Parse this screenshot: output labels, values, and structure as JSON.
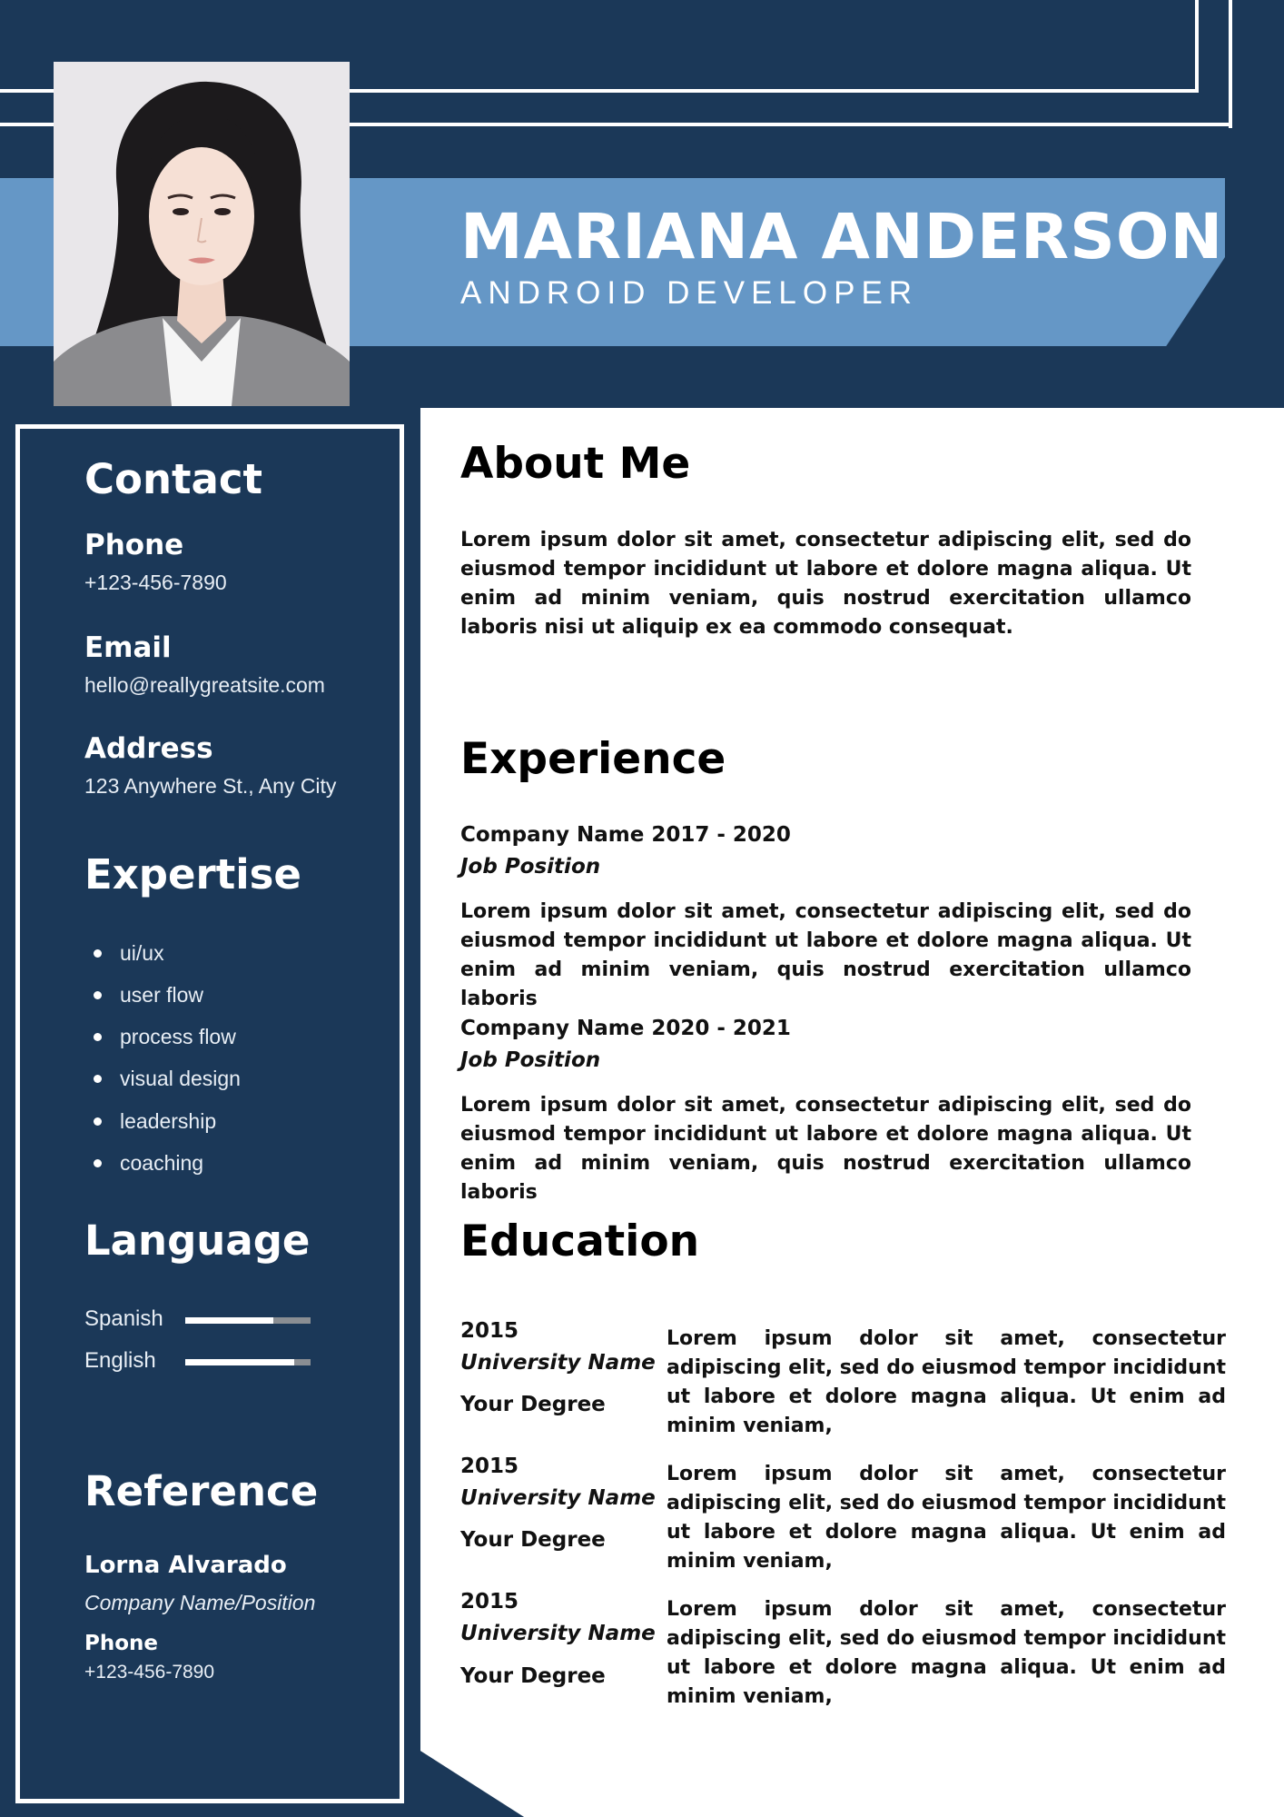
{
  "header": {
    "name": "MARIANA ANDERSON",
    "title": "ANDROID DEVELOPER"
  },
  "colors": {
    "navy": "#1b3858",
    "banner_blue": "#6597c6",
    "white": "#ffffff"
  },
  "sidebar": {
    "contact": {
      "heading": "Contact",
      "phone_label": "Phone",
      "phone_value": "+123-456-7890",
      "email_label": "Email",
      "email_value": "hello@reallygreatsite.com",
      "address_label": "Address",
      "address_value": "123 Anywhere St., Any City"
    },
    "expertise": {
      "heading": "Expertise",
      "items": [
        "ui/ux",
        "user flow",
        "process flow",
        "visual design",
        "leadership",
        "coaching"
      ]
    },
    "language": {
      "heading": "Language",
      "items": [
        {
          "label": "Spanish",
          "level": 0.7
        },
        {
          "label": "English",
          "level": 0.87
        }
      ]
    },
    "reference": {
      "heading": "Reference",
      "name": "Lorna Alvarado",
      "company": "Company Name/Position",
      "phone_label": "Phone",
      "phone_value": "+123-456-7890"
    }
  },
  "main": {
    "about": {
      "heading": "About Me",
      "text": "Lorem ipsum dolor sit amet, consectetur adipiscing elit, sed do eiusmod tempor incididunt ut labore et dolore magna aliqua. Ut enim ad minim veniam, quis nostrud exercitation ullamco laboris nisi ut aliquip ex ea commodo consequat."
    },
    "experience": {
      "heading": "Experience",
      "jobs": [
        {
          "company": "Company Name 2017 - 2020",
          "position": "Job Position",
          "text": "Lorem ipsum dolor sit amet, consectetur adipiscing elit, sed do eiusmod tempor incididunt ut labore et dolore magna aliqua. Ut enim ad minim veniam, quis nostrud exercitation ullamco laboris"
        },
        {
          "company": "Company Name 2020 - 2021",
          "position": "Job Position",
          "text": "Lorem ipsum dolor sit amet, consectetur adipiscing elit, sed do eiusmod tempor incididunt ut labore et dolore magna aliqua. Ut enim ad minim veniam, quis nostrud exercitation ullamco laboris"
        }
      ]
    },
    "education": {
      "heading": "Education",
      "entries": [
        {
          "year": "2015",
          "university": "University Name",
          "degree": "Your Degree",
          "text": "Lorem ipsum dolor sit amet, consectetur adipiscing elit, sed do eiusmod tempor incididunt ut labore et dolore magna aliqua. Ut enim ad minim veniam,"
        },
        {
          "year": "2015",
          "university": "University Name",
          "degree": "Your Degree",
          "text": "Lorem ipsum dolor sit amet, consectetur adipiscing elit, sed do eiusmod tempor incididunt ut labore et dolore magna aliqua. Ut enim ad minim veniam,"
        },
        {
          "year": "2015",
          "university": "University Name",
          "degree": "Your Degree",
          "text": "Lorem ipsum dolor sit amet, consectetur adipiscing elit, sed do eiusmod tempor incididunt ut labore et dolore magna aliqua. Ut enim ad minim veniam,"
        }
      ]
    }
  }
}
